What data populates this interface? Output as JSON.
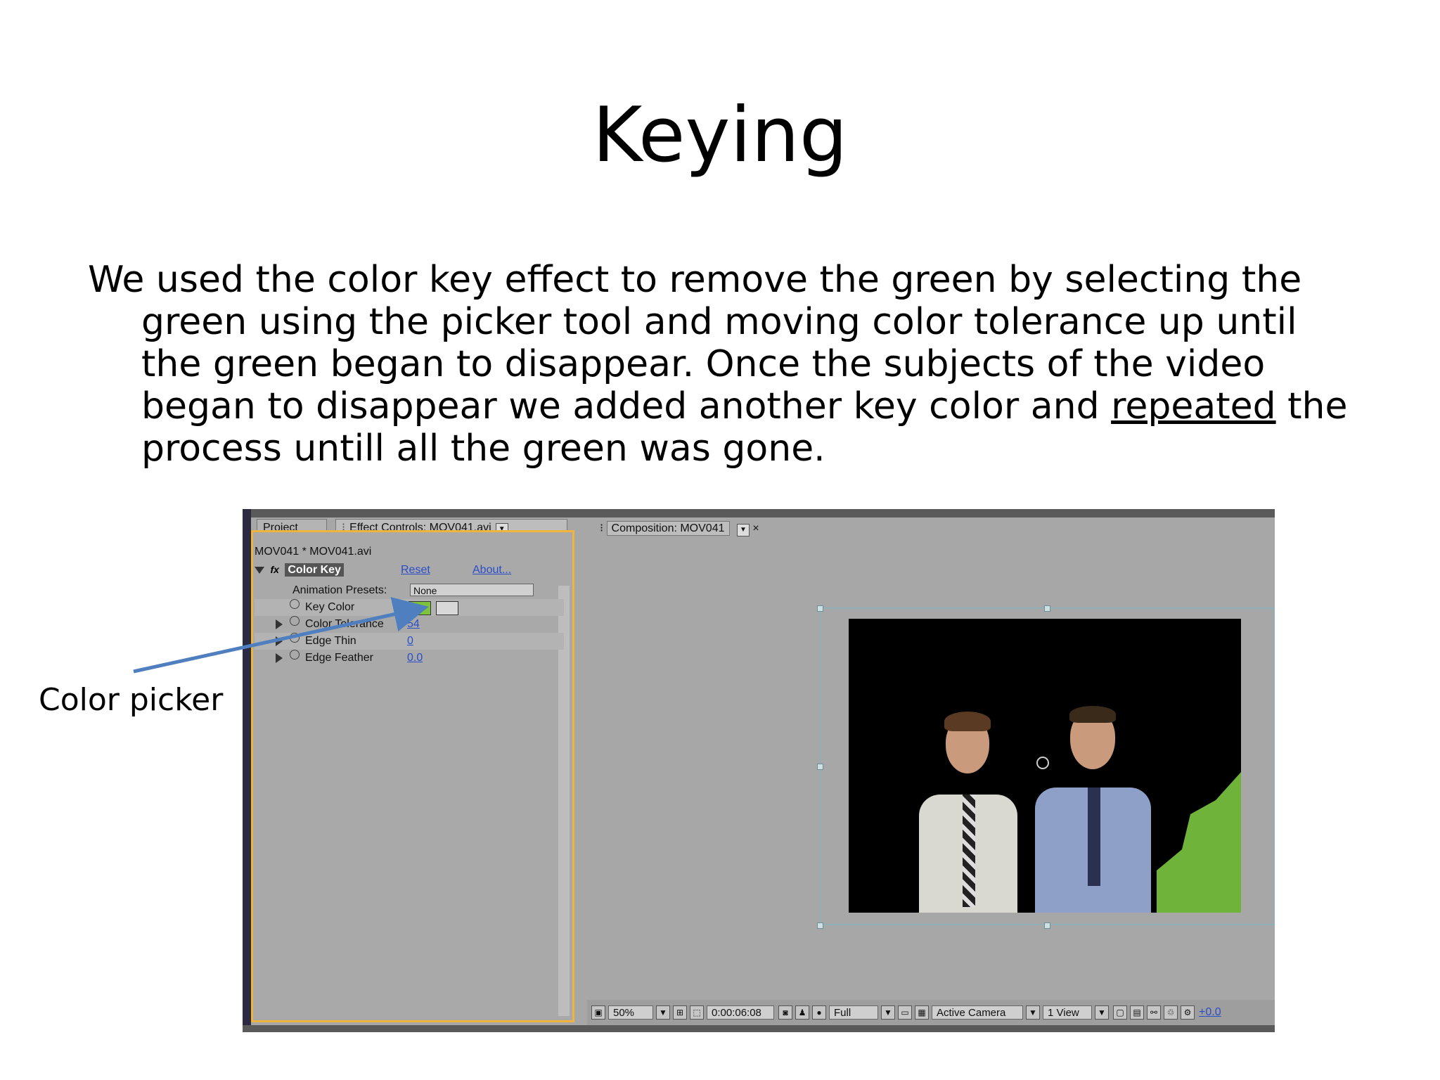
{
  "slide": {
    "title": "Keying",
    "body_part1": "We used the color key effect to remove the green by selecting the green using the picker tool and moving color tolerance up until the green began to disappear. Once the subjects of the video began to disappear we added another key color and ",
    "body_underlined": "repeated",
    "body_part2": " the process untill all the green was gone.",
    "annotation": "Color picker"
  },
  "screenshot": {
    "tabs": {
      "project": "Project",
      "effect_controls": "Effect Controls: MOV041.avi",
      "composition": "Composition: MOV041",
      "close": "×"
    },
    "file_row": "MOV041 * MOV041.avi",
    "effect": {
      "name": "Color Key",
      "reset": "Reset",
      "about": "About...",
      "presets_label": "Animation Presets:",
      "presets_value": "None"
    },
    "params": [
      {
        "label": "Key Color",
        "value": ""
      },
      {
        "label": "Color Tolerance",
        "value": "54"
      },
      {
        "label": "Edge Thin",
        "value": "0"
      },
      {
        "label": "Edge Feather",
        "value": "0.0"
      }
    ],
    "status": {
      "zoom": "50%",
      "timecode": "0:00:06:08",
      "resolution": "Full",
      "camera": "Active Camera",
      "view": "1 View",
      "exposure": "+0.0"
    },
    "colors": {
      "panel_highlight": "#f0b43c",
      "key_green": "#7fc23b",
      "arrow": "#4f7fbf"
    }
  }
}
